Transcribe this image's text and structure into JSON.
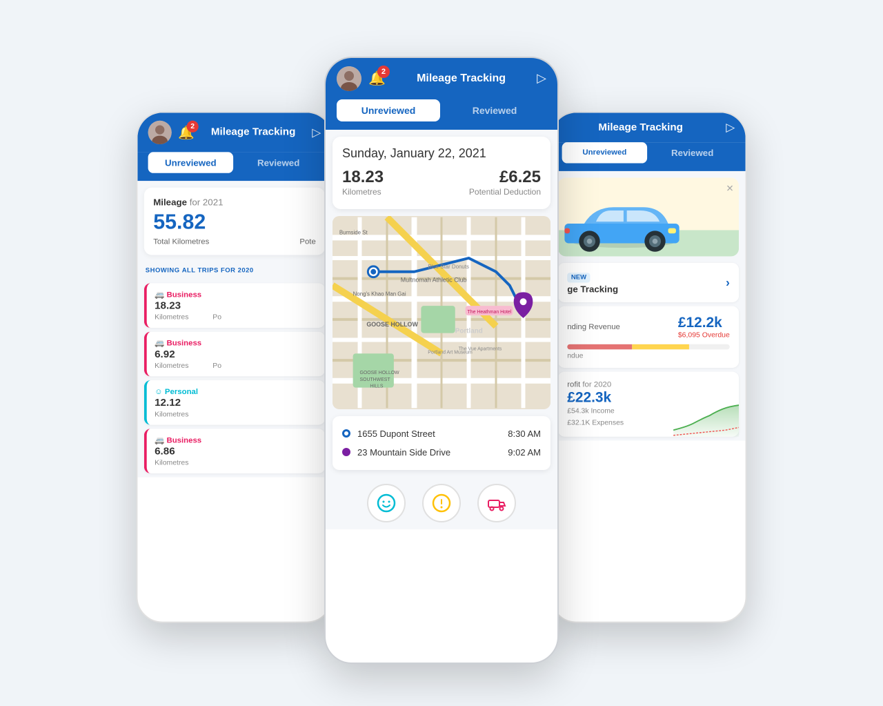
{
  "left_phone": {
    "header": {
      "title": "Mileage Tracking",
      "notification_count": "2"
    },
    "tabs": {
      "active": "Unreviewed",
      "inactive": "Reviewed"
    },
    "summary": {
      "title": "Mileage",
      "year": "for 2021",
      "total_km": "55.82",
      "total_label": "Total Kilometres",
      "potential_label": "Pote"
    },
    "showing_label": "SHOWING",
    "showing_highlight": "ALL TRIPS FOR 2020",
    "trips": [
      {
        "type": "Business",
        "km": "18.23",
        "label": "Kilometres",
        "suffix": "Po",
        "personal": false
      },
      {
        "type": "Business",
        "km": "6.92",
        "label": "Kilometres",
        "suffix": "Po",
        "personal": false
      },
      {
        "type": "Personal",
        "km": "12.12",
        "label": "Kilometres",
        "suffix": "",
        "personal": true
      },
      {
        "type": "Business",
        "km": "6.86",
        "label": "Kilometres",
        "suffix": "",
        "personal": false
      }
    ]
  },
  "center_phone": {
    "header": {
      "title": "Mileage Tracking",
      "notification_count": "2"
    },
    "tabs": {
      "active": "Unreviewed",
      "inactive": "Reviewed"
    },
    "date": "Sunday, January 22, 2021",
    "stats": {
      "km": "18.23",
      "km_label": "Kilometres",
      "deduction": "£6.25",
      "deduction_label": "Potential Deduction"
    },
    "route": {
      "start": "1655 Dupont Street",
      "start_time": "8:30 AM",
      "end": "23 Mountain Side Drive",
      "end_time": "9:02 AM"
    },
    "bottom_icons": [
      "smiley",
      "warning",
      "truck"
    ]
  },
  "right_phone": {
    "header": {
      "title": "Mileage Tracking"
    },
    "tabs": {
      "active": "Unreviewed",
      "inactive": "Reviewed"
    },
    "new_tracking": {
      "badge": "NEW",
      "label": "ge Tracking"
    },
    "revenue": {
      "label": "nding Revenue",
      "amount": "£12.2k",
      "overdue": "$6,095 Overdue",
      "due_label": "ndue",
      "progress_red": 40,
      "progress_yellow": 35
    },
    "profit": {
      "label": "rofit",
      "year": "for 2020",
      "amount": "£22.3k",
      "income": "£54.3k Income",
      "expenses": "£32.1K Expenses"
    }
  }
}
